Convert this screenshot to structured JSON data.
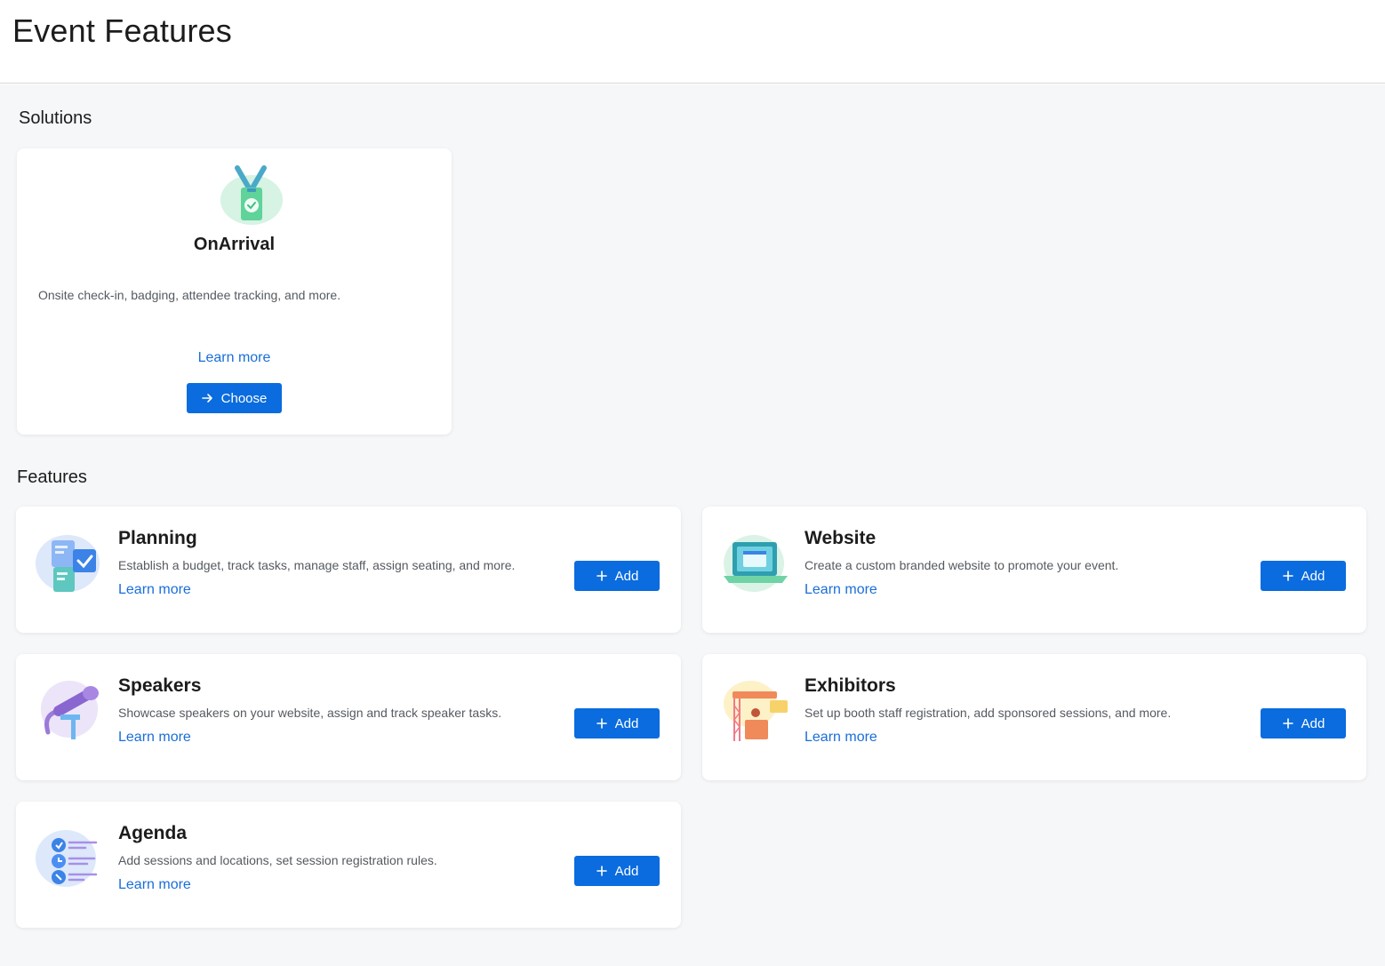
{
  "header": {
    "title": "Event Features"
  },
  "solutions": {
    "title": "Solutions",
    "items": [
      {
        "name": "OnArrival",
        "description": "Onsite check-in, badging, attendee tracking, and more.",
        "learn_more": "Learn more",
        "button": "Choose",
        "icon": "badge-icon"
      }
    ]
  },
  "features": {
    "title": "Features",
    "items": [
      {
        "name": "Planning",
        "description": "Establish a budget, track tasks, manage staff, assign seating, and more.",
        "learn_more": "Learn more",
        "button": "Add",
        "icon": "planning-icon"
      },
      {
        "name": "Website",
        "description": "Create a custom branded website to promote your event.",
        "learn_more": "Learn more",
        "button": "Add",
        "icon": "laptop-icon"
      },
      {
        "name": "Speakers",
        "description": "Showcase speakers on your website, assign and track speaker tasks.",
        "learn_more": "Learn more",
        "button": "Add",
        "icon": "microphone-icon"
      },
      {
        "name": "Exhibitors",
        "description": "Set up booth staff registration, add sponsored sessions, and more.",
        "learn_more": "Learn more",
        "button": "Add",
        "icon": "booth-icon"
      },
      {
        "name": "Agenda",
        "description": "Add sessions and locations, set session registration rules.",
        "learn_more": "Learn more",
        "button": "Add",
        "icon": "agenda-icon"
      }
    ]
  },
  "colors": {
    "accent": "#0a6cde",
    "link": "#1a6ed8",
    "background": "#f6f7f9"
  }
}
